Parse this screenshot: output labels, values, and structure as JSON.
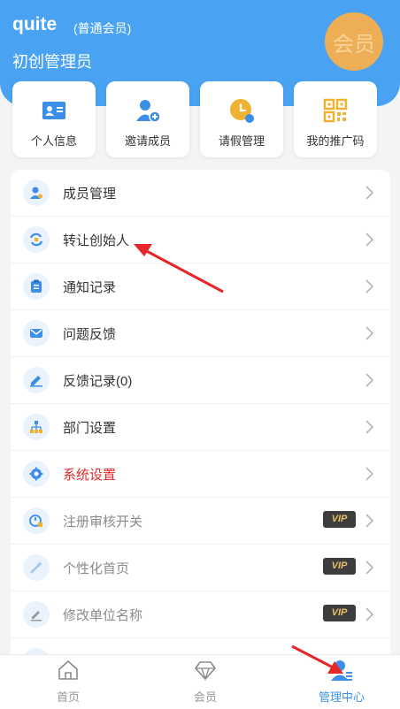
{
  "header": {
    "user_name": "quite",
    "member_type": "(普通会员)",
    "role": "初创管理员",
    "badge_text": "会员"
  },
  "quick_actions": [
    {
      "label": "个人信息",
      "icon": "id-card-icon"
    },
    {
      "label": "邀请成员",
      "icon": "add-user-icon"
    },
    {
      "label": "请假管理",
      "icon": "clock-icon"
    },
    {
      "label": "我的推广码",
      "icon": "qr-code-icon"
    }
  ],
  "menu": [
    {
      "label": "成员管理",
      "icon": "member-icon"
    },
    {
      "label": "转让创始人",
      "icon": "transfer-icon"
    },
    {
      "label": "通知记录",
      "icon": "notice-icon"
    },
    {
      "label": "问题反馈",
      "icon": "feedback-icon"
    },
    {
      "label": "反馈记录(0)",
      "icon": "record-icon"
    },
    {
      "label": "部门设置",
      "icon": "department-icon"
    },
    {
      "label": "系统设置",
      "icon": "settings-icon"
    },
    {
      "label": "注册审核开关",
      "icon": "audit-icon",
      "vip": "VIP"
    },
    {
      "label": "个性化首页",
      "icon": "magic-wand-icon",
      "vip": "VIP"
    },
    {
      "label": "修改单位名称",
      "icon": "edit-icon",
      "vip": "VIP"
    }
  ],
  "tabs": [
    {
      "label": "首页",
      "icon": "home-icon"
    },
    {
      "label": "会员",
      "icon": "diamond-icon"
    },
    {
      "label": "管理中心",
      "icon": "admin-icon"
    }
  ],
  "colors": {
    "primary": "#49a3f2",
    "badge": "#eeae55",
    "danger": "#e02b2b",
    "annotation": "#e8262a"
  }
}
